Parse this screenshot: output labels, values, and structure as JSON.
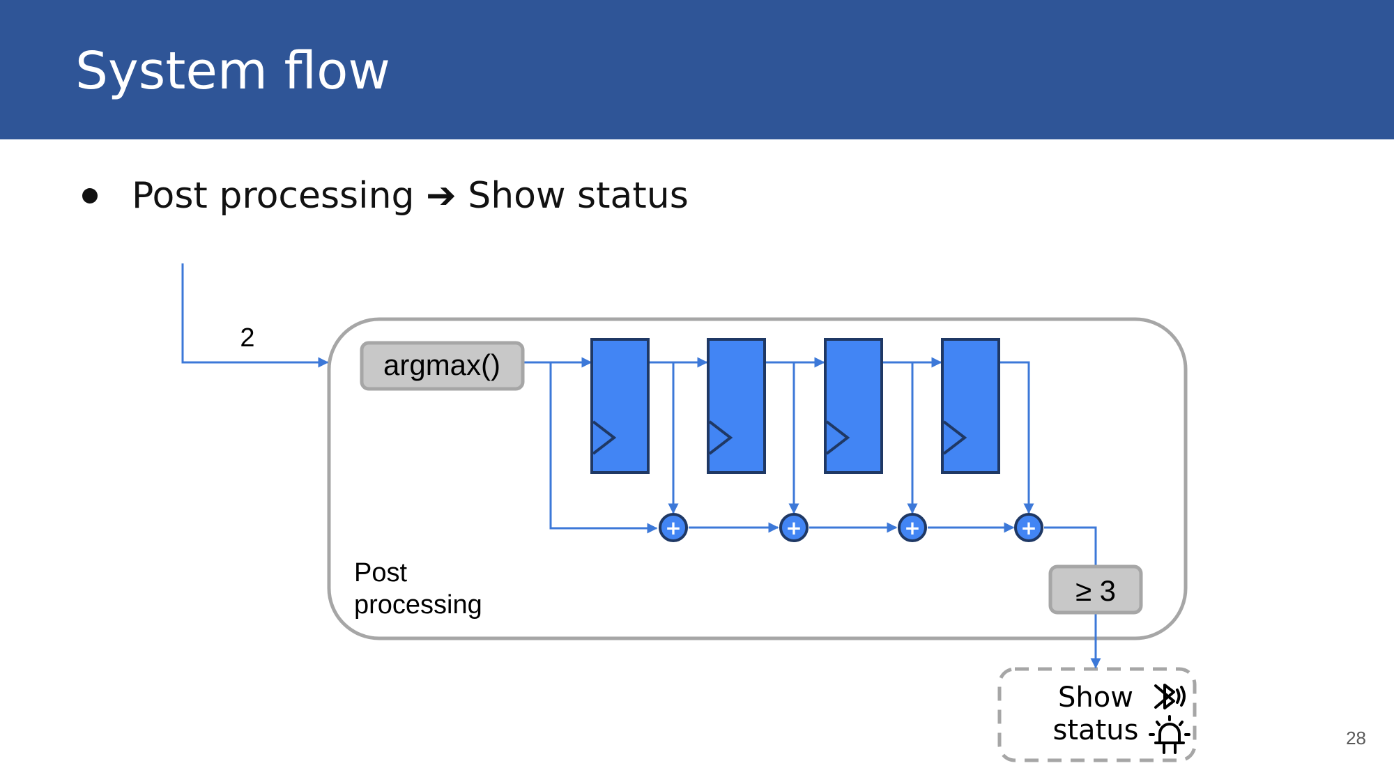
{
  "slide": {
    "title": "System flow",
    "bullet_text": "Post processing ➔ Show status",
    "page_number": "28"
  },
  "diagram": {
    "input_label": "2",
    "argmax_label": "argmax()",
    "group_label_line1": "Post",
    "group_label_line2": "processing",
    "threshold_label": "≥ 3",
    "output_label_line1": "Show",
    "output_label_line2": "status",
    "register_count": 4,
    "adder_symbol": "+",
    "output_icons": [
      "bluetooth-icon",
      "alarm-light-icon"
    ]
  },
  "colors": {
    "header_bg": "#2f5597",
    "register_fill": "#4285f4",
    "register_stroke": "#1f3864",
    "wire": "#3c78d8",
    "box_fill": "#c8c8c8",
    "box_stroke": "#a6a6a6"
  }
}
